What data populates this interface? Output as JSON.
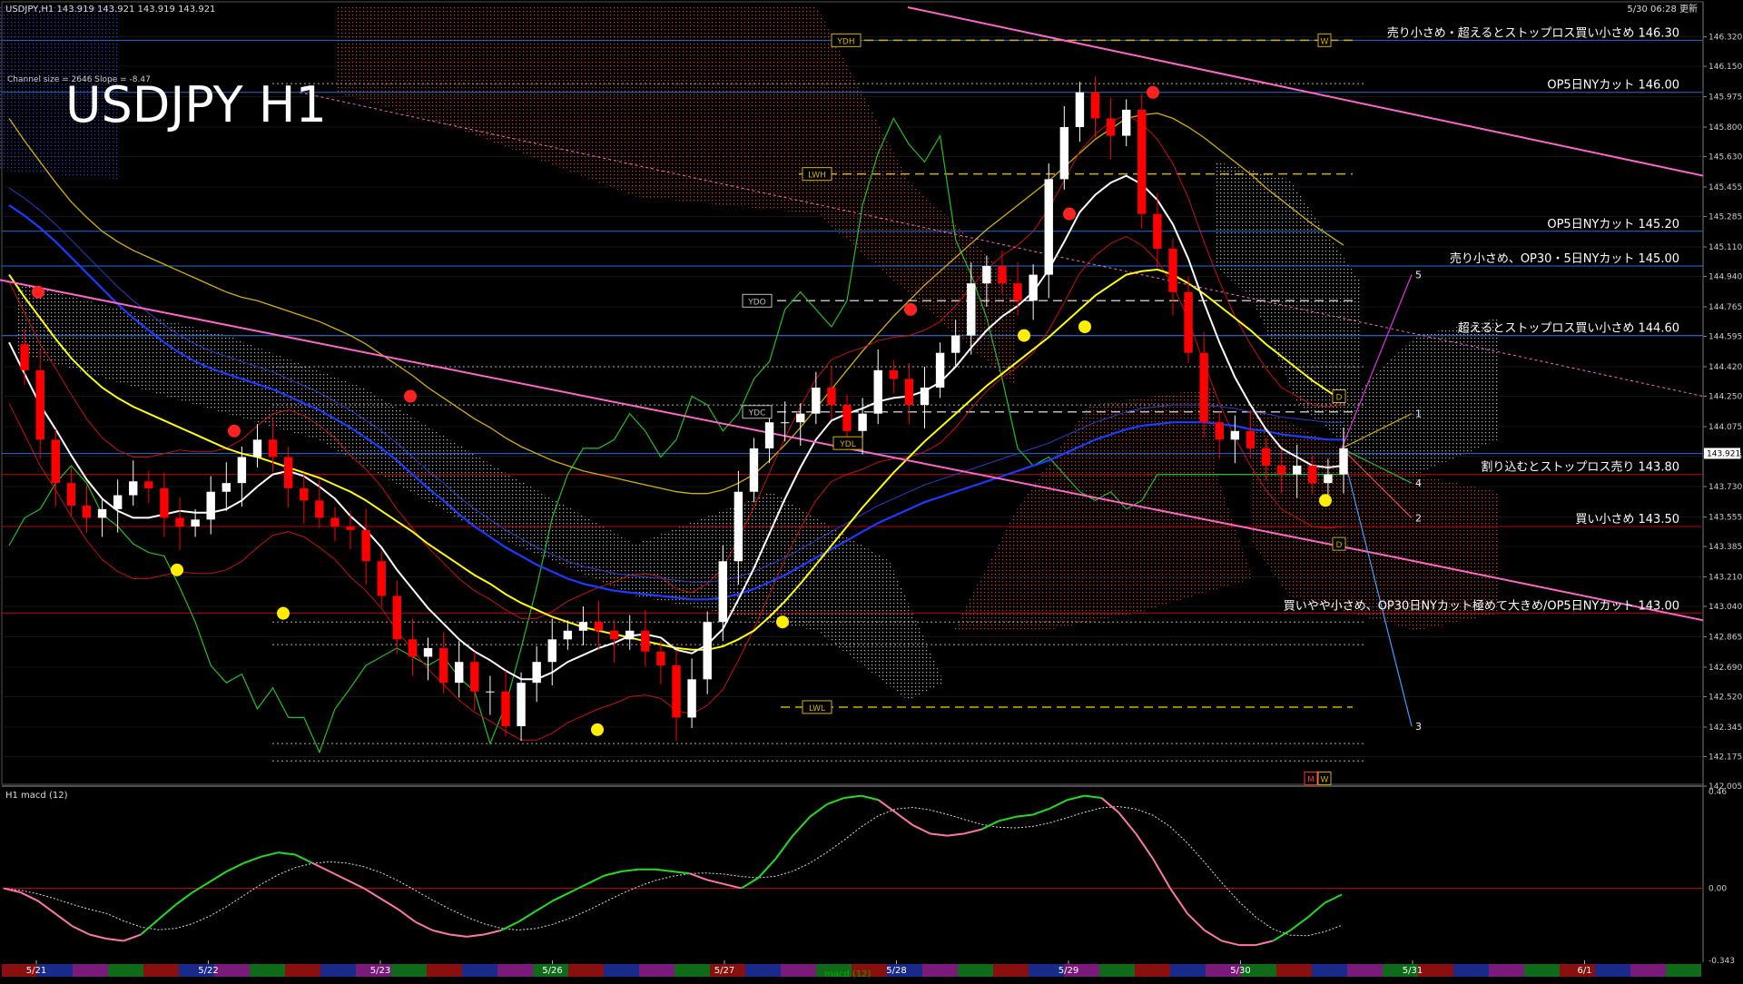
{
  "window": {
    "symbol_header": "USDJPY,H1  143.919 143.921 143.919 143.921",
    "updated": "5/30 06:28 更新",
    "title": "USDJPY H1",
    "channel_info": "Channel size = 2646 Slope = -8.47"
  },
  "colors": {
    "background": "#000000",
    "bull_candle": "#ffffff",
    "bear_candle": "#ff0000",
    "sma_short": "#ffffff",
    "sma_mid": "#ffff00",
    "sma_long": "#1a3cff",
    "channel": "#ff66cc",
    "kumo_bear": "#ff5533",
    "kumo_bull": "#dddddd",
    "chikou": "#22c022",
    "kijun_line": "#d4b000",
    "level_line": "#1f6fd6",
    "red_level": "#c00000",
    "macd_bull": "#22dd22",
    "macd_bear": "#ff77aa"
  },
  "chart_data": [
    {
      "type": "candlestick",
      "ylim": [
        142.005,
        146.49
      ],
      "y_ticks": [
        "146.320",
        "146.150",
        "145.975",
        "145.800",
        "145.630",
        "145.455",
        "145.285",
        "145.110",
        "144.940",
        "144.765",
        "144.595",
        "144.420",
        "144.250",
        "144.075",
        "143.905",
        "143.730",
        "143.555",
        "143.385",
        "143.210",
        "143.040",
        "142.865",
        "142.690",
        "142.520",
        "142.345",
        "142.175",
        "142.005"
      ],
      "current_price": "143.921",
      "x_ticks": [
        "5/21",
        "5/22",
        "5/23",
        "5/26",
        "5/27",
        "5/28",
        "5/29",
        "5/30",
        "5/31",
        "6/1"
      ],
      "annotations": [
        {
          "price": 146.3,
          "text": "売り小さめ・超えるとストップロス買い小さめ 146.30"
        },
        {
          "price": 146.0,
          "text": "OP5日NYカット 146.00"
        },
        {
          "price": 145.2,
          "text": "OP5日NYカット 145.20"
        },
        {
          "price": 145.0,
          "text": "売り小さめ、OP30・5日NYカット 145.00"
        },
        {
          "price": 144.6,
          "text": "超えるとストップロス買い小さめ 144.60"
        },
        {
          "price": 143.8,
          "text": "割り込むとストップロス売り 143.80"
        },
        {
          "price": 143.5,
          "text": "買い小さめ 143.50"
        },
        {
          "price": 143.0,
          "text": "買いやや小さめ、OP30日NYカット極めて大きめ/OP5日NYカット 143.00"
        }
      ],
      "markers": [
        "YDH",
        "LWH",
        "YDO",
        "YDC",
        "YDL",
        "LWL",
        "D",
        "D",
        "W",
        "M",
        "W"
      ],
      "projection_labels": [
        "1",
        "2",
        "3",
        "4",
        "5"
      ],
      "close_path": [
        144.55,
        144.4,
        144.0,
        143.75,
        143.62,
        143.55,
        143.6,
        143.68,
        143.76,
        143.72,
        143.55,
        143.5,
        143.54,
        143.7,
        143.75,
        143.9,
        144.0,
        143.9,
        143.72,
        143.65,
        143.55,
        143.5,
        143.48,
        143.3,
        143.1,
        142.85,
        142.75,
        142.8,
        142.6,
        142.72,
        142.55,
        142.55,
        142.35,
        142.6,
        142.72,
        142.85,
        142.9,
        142.95,
        142.9,
        142.85,
        142.9,
        142.78,
        142.7,
        142.4,
        142.62,
        142.95,
        143.3,
        143.7,
        143.95,
        144.1,
        144.1,
        144.15,
        144.3,
        144.2,
        144.05,
        144.15,
        144.4,
        144.35,
        144.2,
        144.3,
        144.5,
        144.6,
        144.9,
        145.0,
        144.9,
        144.8,
        144.95,
        145.5,
        145.8,
        146.0,
        145.85,
        145.75,
        145.9,
        145.3,
        145.1,
        144.85,
        144.5,
        144.1,
        144.0,
        144.05,
        143.95,
        143.85,
        143.8,
        143.85,
        143.75,
        143.8,
        143.95
      ],
      "sma_short": [
        144.56,
        144.38,
        144.2,
        144.06,
        143.91,
        143.77,
        143.66,
        143.59,
        143.55,
        143.55,
        143.57,
        143.59,
        143.58,
        143.58,
        143.6,
        143.65,
        143.73,
        143.8,
        143.82,
        143.79,
        143.73,
        143.66,
        143.56,
        143.48,
        143.38,
        143.25,
        143.14,
        143.03,
        142.94,
        142.85,
        142.78,
        142.73,
        142.67,
        142.62,
        142.62,
        142.66,
        142.72,
        142.76,
        142.8,
        142.83,
        142.87,
        142.88,
        142.86,
        142.79,
        142.77,
        142.82,
        142.91,
        143.08,
        143.26,
        143.46,
        143.66,
        143.84,
        144.0,
        144.11,
        144.15,
        144.18,
        144.22,
        144.24,
        144.25,
        144.28,
        144.33,
        144.42,
        144.53,
        144.63,
        144.71,
        144.77,
        144.85,
        144.98,
        145.14,
        145.31,
        145.41,
        145.48,
        145.52,
        145.47,
        145.38,
        145.24,
        145.04,
        144.79,
        144.56,
        144.36,
        144.2,
        144.06,
        143.95,
        143.9,
        143.85,
        143.84,
        143.85
      ],
      "sma_mid": [
        144.95,
        144.82,
        144.7,
        144.58,
        144.47,
        144.38,
        144.3,
        144.24,
        144.19,
        144.15,
        144.11,
        144.07,
        144.03,
        143.99,
        143.95,
        143.92,
        143.9,
        143.87,
        143.84,
        143.81,
        143.78,
        143.74,
        143.7,
        143.65,
        143.59,
        143.53,
        143.47,
        143.4,
        143.34,
        143.28,
        143.22,
        143.17,
        143.11,
        143.06,
        143.02,
        142.98,
        142.95,
        142.92,
        142.9,
        142.88,
        142.86,
        142.84,
        142.82,
        142.8,
        142.79,
        142.79,
        142.81,
        142.85,
        142.9,
        142.98,
        143.07,
        143.17,
        143.28,
        143.39,
        143.5,
        143.61,
        143.71,
        143.81,
        143.9,
        143.99,
        144.07,
        144.15,
        144.23,
        144.31,
        144.38,
        144.45,
        144.52,
        144.59,
        144.67,
        144.75,
        144.83,
        144.89,
        144.95,
        144.97,
        144.98,
        144.95,
        144.9,
        144.84,
        144.77,
        144.7,
        144.63,
        144.55,
        144.48,
        144.41,
        144.34,
        144.28,
        144.22
      ],
      "sma_long": [
        145.35,
        145.29,
        145.22,
        145.14,
        145.05,
        144.96,
        144.87,
        144.78,
        144.7,
        144.63,
        144.56,
        144.5,
        144.45,
        144.41,
        144.38,
        144.35,
        144.32,
        144.29,
        144.25,
        144.21,
        144.17,
        144.12,
        144.07,
        144.01,
        143.95,
        143.88,
        143.8,
        143.72,
        143.65,
        143.57,
        143.5,
        143.44,
        143.38,
        143.33,
        143.28,
        143.24,
        143.2,
        143.17,
        143.15,
        143.13,
        143.12,
        143.11,
        143.1,
        143.09,
        143.08,
        143.08,
        143.09,
        143.11,
        143.14,
        143.18,
        143.22,
        143.27,
        143.32,
        143.37,
        143.42,
        143.47,
        143.52,
        143.56,
        143.6,
        143.64,
        143.67,
        143.7,
        143.73,
        143.76,
        143.79,
        143.82,
        143.85,
        143.88,
        143.92,
        143.96,
        144.0,
        144.03,
        144.06,
        144.08,
        144.09,
        144.1,
        144.1,
        144.1,
        144.09,
        144.08,
        144.06,
        144.05,
        144.03,
        144.02,
        144.01,
        144.0,
        144.0
      ]
    },
    {
      "type": "line",
      "title": "H1 macd (12)",
      "ylim": [
        -0.343,
        0.46
      ],
      "y_ticks": [
        "0.46",
        "0.00",
        "-0.343"
      ],
      "macd": [
        0.0,
        -0.02,
        -0.06,
        -0.12,
        -0.18,
        -0.22,
        -0.24,
        -0.25,
        -0.22,
        -0.15,
        -0.08,
        -0.02,
        0.03,
        0.08,
        0.12,
        0.15,
        0.17,
        0.16,
        0.12,
        0.08,
        0.04,
        0.0,
        -0.05,
        -0.1,
        -0.16,
        -0.2,
        -0.22,
        -0.23,
        -0.22,
        -0.2,
        -0.16,
        -0.11,
        -0.06,
        -0.02,
        0.02,
        0.06,
        0.08,
        0.09,
        0.09,
        0.08,
        0.07,
        0.04,
        0.02,
        0.0,
        0.05,
        0.14,
        0.25,
        0.34,
        0.4,
        0.43,
        0.44,
        0.42,
        0.36,
        0.3,
        0.26,
        0.25,
        0.26,
        0.28,
        0.32,
        0.34,
        0.35,
        0.38,
        0.42,
        0.44,
        0.43,
        0.36,
        0.26,
        0.14,
        0.0,
        -0.12,
        -0.2,
        -0.25,
        -0.27,
        -0.27,
        -0.25,
        -0.2,
        -0.14,
        -0.07,
        -0.03
      ]
    }
  ],
  "bottom_bar": {
    "label": "macd (12)"
  }
}
